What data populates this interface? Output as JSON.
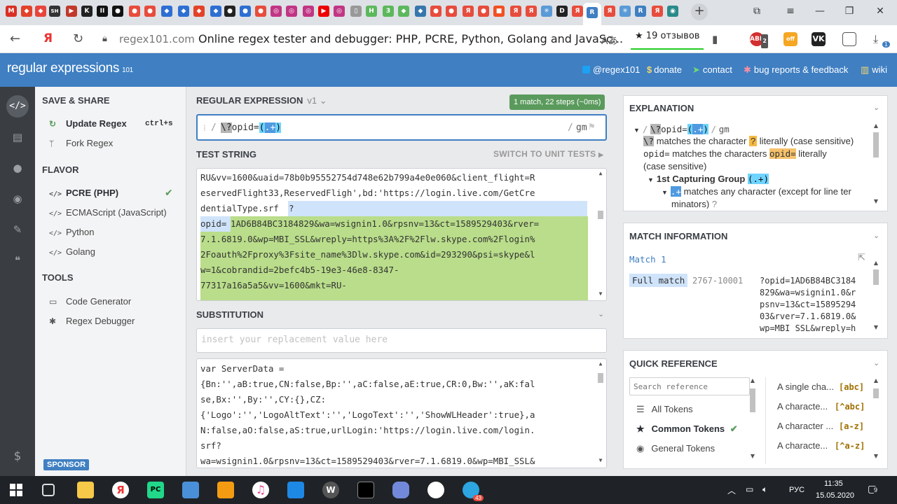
{
  "browser": {
    "url_domain": "regex101.com",
    "page_title": "Online regex tester and debugger: PHP, PCRE, Python, Golang and JavaSc...",
    "reviews": "19 отзывов",
    "yandex_label": "Я",
    "tab_label_sh": "SH",
    "ext_badge_1": "2",
    "ext_badge_2": "1"
  },
  "header": {
    "logo": "regular expressions",
    "logo_sub": "101",
    "links": {
      "twitter": "@regex101",
      "donate": "donate",
      "contact": "contact",
      "bugs": "bug reports & feedback",
      "wiki": "wiki"
    }
  },
  "sidebar": {
    "save_share_title": "SAVE & SHARE",
    "update_regex": "Update Regex",
    "update_shortcut": "ctrl+s",
    "fork_regex": "Fork Regex",
    "flavor_title": "FLAVOR",
    "flavors": [
      "PCRE (PHP)",
      "ECMAScript (JavaScript)",
      "Python",
      "Golang"
    ],
    "tools_title": "TOOLS",
    "tools": [
      "Code Generator",
      "Regex Debugger"
    ],
    "sponsor": "SPONSOR"
  },
  "regex": {
    "title": "REGULAR EXPRESSION",
    "version": "v1",
    "match_summary": "1 match, 22 steps (~0ms)",
    "open_delim": "/",
    "tok_escape": "\\?",
    "tok_literal": "opid=",
    "tok_group_open": "(",
    "tok_dot": ".+",
    "tok_group_close": ")",
    "close_delim": "/",
    "flags": "gm"
  },
  "test_string": {
    "title": "TEST STRING",
    "switch_label": "SWITCH TO UNIT TESTS",
    "lines": [
      "RU&vv=1600&uaid=78b0b95552754d748e62b799a4e0e060&client_flight=R",
      "eservedFlight33,ReservedFligh',bd:'https://login.live.com/GetCre",
      "dentialType.srf",
      "?",
      "opid=",
      "1AD6B84BC3184829&wa=wsignin1.0&rpsnv=13&ct=1589529403&rver=",
      "7.1.6819.0&wp=MBI_SSL&wreply=https%3A%2F%2Flw.skype.com%2Flogin%",
      "2Foauth%2Fproxy%3Fsite_name%3Dlw.skype.com&id=293290&psi=skype&l",
      "w=1&cobrandid=2befc4b5-19e3-46e8-8347-",
      "77317a16a5a5&vv=1600&mkt=RU-"
    ]
  },
  "substitution": {
    "title": "SUBSTITUTION",
    "placeholder": "insert your replacement value here",
    "lines": [
      "var ServerData =",
      "{Bn:'',aB:true,CN:false,Bp:'',aC:false,aE:true,CR:0,Bw:'',aK:fal",
      "se,Bx:'',By:'',CY:{},CZ:",
      "{'Logo':'','LogoAltText':'','LogoText':'','ShowWLHeader':true},a",
      "N:false,aO:false,aS:true,urlLogin:'https://login.live.com/login.",
      "srf?",
      "wa=wsignin1.0&rpsnv=13&ct=1589529403&rver=7.1.6819.0&wp=MBI_SSL&"
    ]
  },
  "explanation": {
    "title": "EXPLANATION",
    "root_delim_open": "/",
    "root_delim_close": "/",
    "root_flags": "gm",
    "line1_desc": "matches the character",
    "line1_char": "?",
    "line1_tail": "literally (case sensitive)",
    "line2_desc": "matches the characters",
    "line2_tail": "literally",
    "line3": "(case sensitive)",
    "group_label": "1st Capturing Group",
    "group_token": "(.+)",
    "dot_desc": "matches any character (except for line ter",
    "dot_desc2": "minators)"
  },
  "match_info": {
    "title": "MATCH INFORMATION",
    "match_label": "Match 1",
    "full_match": "Full match",
    "range": "2767-10001",
    "value_lines": [
      "?opid=1AD6B84BC3184",
      "829&wa=wsignin1.0&r",
      "psnv=13&ct=15895294",
      "03&rver=7.1.6819.0&",
      "wp=MBI_SSL&wreply=h"
    ]
  },
  "quick_ref": {
    "title": "QUICK REFERENCE",
    "search_placeholder": "Search reference",
    "categories": [
      "All Tokens",
      "Common Tokens",
      "General Tokens"
    ],
    "entries": [
      {
        "label": "A single cha...",
        "token": "[abc]"
      },
      {
        "label": "A characte...",
        "token": "[^abc]"
      },
      {
        "label": "A character ...",
        "token": "[a-z]"
      },
      {
        "label": "A characte...",
        "token": "[^a-z]"
      }
    ]
  },
  "taskbar": {
    "lang": "РУС",
    "time": "11:35",
    "date": "15.05.2020",
    "notif_count": "9",
    "telegram_badge": "43"
  }
}
